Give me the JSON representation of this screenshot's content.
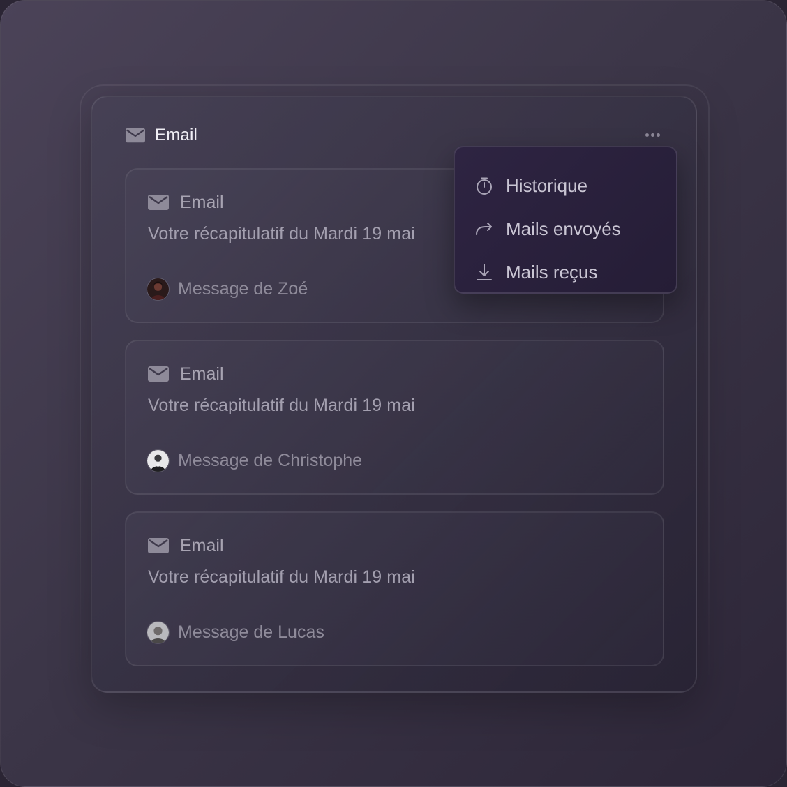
{
  "widget": {
    "title": "Email",
    "more_button_icon": "more-horizontal-icon"
  },
  "cards": [
    {
      "label": "Email",
      "icon": "mail-icon",
      "subject": "Votre récapitulatif du Mardi 19 mai",
      "message": "Message de Zoé",
      "avatar": "zoe-avatar"
    },
    {
      "label": "Email",
      "icon": "mail-icon",
      "subject": "Votre récapitulatif du Mardi 19 mai",
      "message": "Message de Christophe",
      "avatar": "christophe-avatar"
    },
    {
      "label": "Email",
      "icon": "mail-icon",
      "subject": "Votre récapitulatif du Mardi 19 mai",
      "message": "Message de Lucas",
      "avatar": "lucas-avatar"
    }
  ],
  "menu": {
    "items": [
      {
        "label": "Historique",
        "icon": "stopwatch-icon"
      },
      {
        "label": "Mails envoyés",
        "icon": "forward-arrow-icon"
      },
      {
        "label": "Mails reçus",
        "icon": "download-icon"
      }
    ]
  },
  "colors": {
    "background": "#3c3648",
    "menu_background": "#2a2140",
    "text_primary": "#f0eef5",
    "text_muted": "#a39faf"
  }
}
